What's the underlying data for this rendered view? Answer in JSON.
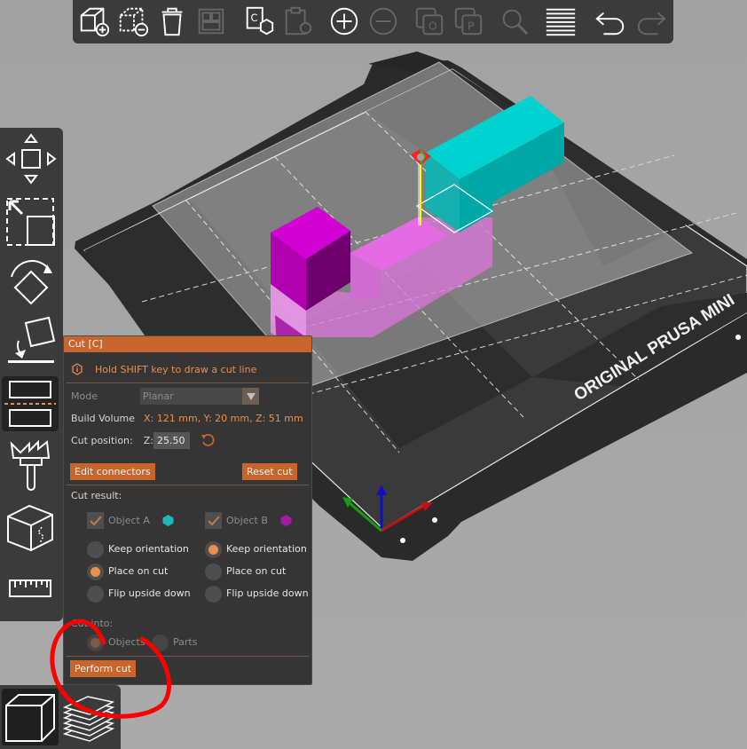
{
  "top_toolbar": {
    "items": [
      {
        "icon": "add-object-icon",
        "enabled": true
      },
      {
        "icon": "delete-icon",
        "enabled": true
      },
      {
        "icon": "delete-all-icon",
        "enabled": true
      },
      {
        "icon": "arrange-icon",
        "enabled": false
      },
      {
        "icon": "copy-icon",
        "enabled": true
      },
      {
        "icon": "paste-icon",
        "enabled": false
      },
      {
        "icon": "add-instance-icon",
        "enabled": true
      },
      {
        "icon": "remove-instance-icon",
        "enabled": false
      },
      {
        "icon": "split-to-objects-icon",
        "enabled": false
      },
      {
        "icon": "split-to-parts-icon",
        "enabled": false
      },
      {
        "icon": "search-icon",
        "enabled": false
      },
      {
        "icon": "layers-editing-icon",
        "enabled": true
      },
      {
        "icon": "undo-icon",
        "enabled": true
      },
      {
        "icon": "redo-icon",
        "enabled": false
      }
    ]
  },
  "left_toolbar": {
    "items": [
      {
        "icon": "move-icon"
      },
      {
        "icon": "scale-icon"
      },
      {
        "icon": "rotate-icon"
      },
      {
        "icon": "place-on-face-icon"
      },
      {
        "icon": "cut-icon",
        "active": true
      },
      {
        "icon": "paint-supports-icon"
      },
      {
        "icon": "seam-painting-icon"
      },
      {
        "icon": "measure-icon"
      }
    ]
  },
  "view_selector": {
    "items": [
      {
        "icon": "3d-view-icon",
        "active": true
      },
      {
        "icon": "preview-icon",
        "active": false
      }
    ]
  },
  "bed": {
    "label": "ORIGINAL PRUSA MINI"
  },
  "cut_panel": {
    "title": "Cut [C]",
    "hint": "Hold SHIFT key to draw a cut line",
    "mode_label": "Mode",
    "mode_value": "Planar",
    "build_volume_label": "Build Volume",
    "build_volume_value": "X: 121 mm,  Y: 20 mm,  Z: 51 mm",
    "cut_position_label": "Cut position:",
    "axis_label": "Z:",
    "cut_position_value": "25.50",
    "edit_connectors_label": "Edit connectors",
    "reset_cut_label": "Reset cut",
    "cut_result_label": "Cut result:",
    "object_a": {
      "label": "Object A",
      "color": "#1fb7b7",
      "checked": true,
      "options": [
        {
          "label": "Keep orientation",
          "selected": false
        },
        {
          "label": "Place on cut",
          "selected": true
        },
        {
          "label": "Flip upside down",
          "selected": false
        }
      ]
    },
    "object_b": {
      "label": "Object B",
      "color": "#a31aa3",
      "checked": true,
      "options": [
        {
          "label": "Keep orientation",
          "selected": true
        },
        {
          "label": "Place on cut",
          "selected": false
        },
        {
          "label": "Flip upside down",
          "selected": false
        }
      ]
    },
    "cut_into_label": "Cut into:",
    "cut_into_options": [
      {
        "label": "Objects",
        "selected": true
      },
      {
        "label": "Parts",
        "selected": false
      }
    ],
    "perform_cut_label": "Perform cut"
  },
  "colors": {
    "accent": "#c7652c",
    "accent_text": "#ee8e4c",
    "panel_bg": "#353535",
    "toolbar_bg": "#3b3b3b",
    "background": "#a4a4a4",
    "object_a": "#1fb7b7",
    "object_b": "#a31aa3",
    "annotation": "#ff0000"
  }
}
